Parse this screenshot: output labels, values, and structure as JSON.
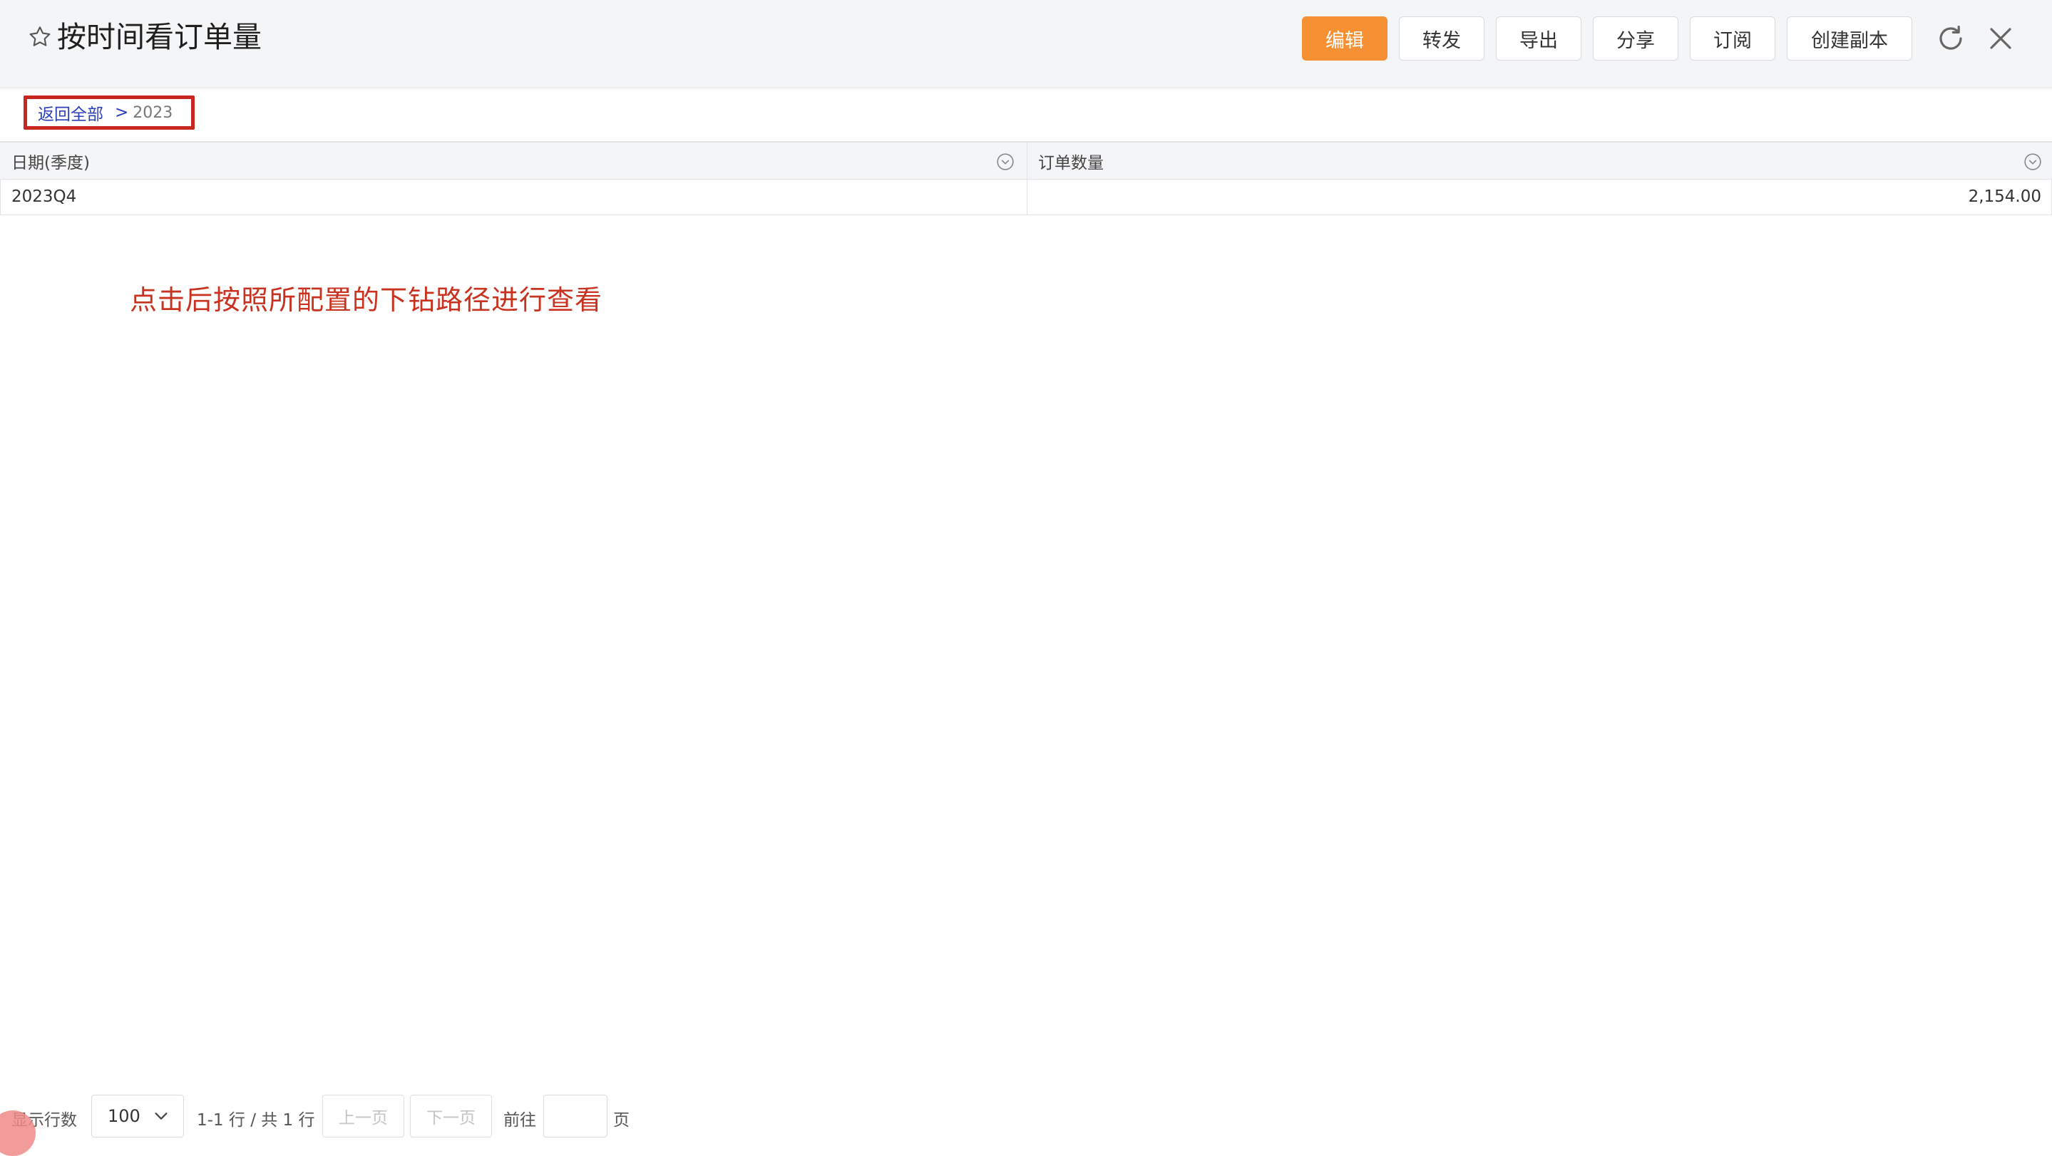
{
  "header": {
    "title": "按时间看订单量",
    "buttons": {
      "edit": "编辑",
      "forward": "转发",
      "export": "导出",
      "share": "分享",
      "subscribe": "订阅",
      "duplicate": "创建副本"
    },
    "icons": {
      "favorite": "star-outline-icon",
      "refresh": "refresh-icon",
      "close": "close-icon"
    }
  },
  "breadcrumb": {
    "back": "返回全部",
    "separator": ">",
    "current": "2023"
  },
  "table": {
    "columns": [
      "日期(季度)",
      "订单数量"
    ],
    "rows": [
      [
        "2023Q4",
        "2,154.00"
      ]
    ]
  },
  "annotation": "点击后按照所配置的下钻路径进行查看",
  "pagination": {
    "rows_label": "显示行数",
    "rows_value": "100",
    "range_text": "1-1 行 / 共 1 行",
    "prev": "上一页",
    "next": "下一页",
    "goto_label": "前往",
    "page_label": "页",
    "goto_value": ""
  },
  "colors": {
    "primary": "#f59133",
    "link": "#2a3fb8",
    "highlight": "#c7271f",
    "annotation": "#c8321f"
  }
}
